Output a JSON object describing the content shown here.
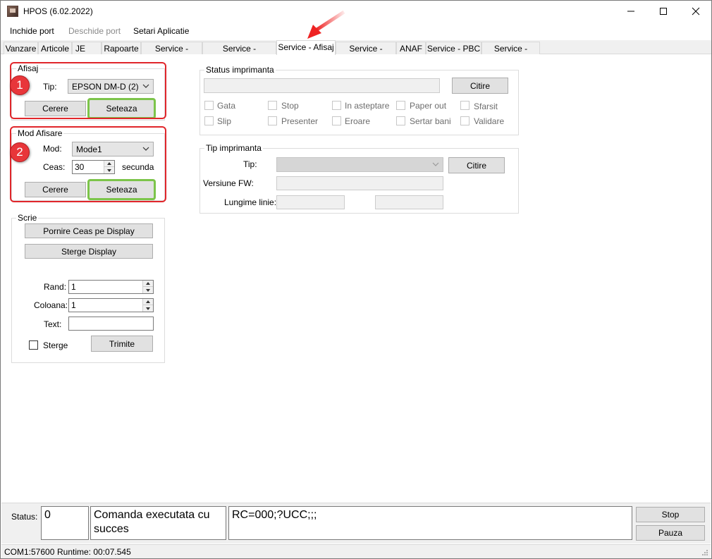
{
  "window": {
    "title": "HPOS (6.02.2022)",
    "controls": {
      "minimize": "—",
      "maximize": "☐",
      "close": "✕"
    }
  },
  "menu": {
    "items": [
      {
        "label": "Inchide port",
        "enabled": true
      },
      {
        "label": "Deschide port",
        "enabled": false
      },
      {
        "label": "Setari Aplicatie",
        "enabled": true
      }
    ]
  },
  "tabs": [
    {
      "label": "Vanzare"
    },
    {
      "label": "Articole"
    },
    {
      "label": "JE"
    },
    {
      "label": "Rapoarte"
    },
    {
      "label": "Service - Fisiere"
    },
    {
      "label": "Service - Fiscalizare"
    },
    {
      "label": "Service - Afisaj",
      "active": true
    },
    {
      "label": "Service - Status"
    },
    {
      "label": "ANAF"
    },
    {
      "label": "Service - PBC"
    },
    {
      "label": "Service - Istoric"
    }
  ],
  "afisaj": {
    "legend": "Afisaj",
    "badge": "1",
    "tip_label": "Tip:",
    "tip_value": "EPSON DM-D (2)",
    "cerere": "Cerere",
    "seteaza": "Seteaza"
  },
  "mod_afisare": {
    "legend": "Mod Afisare",
    "badge": "2",
    "mod_label": "Mod:",
    "mod_value": "Mode1",
    "ceas_label": "Ceas:",
    "ceas_value": "30",
    "unit": "secunda",
    "cerere": "Cerere",
    "seteaza": "Seteaza"
  },
  "scrie": {
    "legend": "Scrie",
    "pornire": "Pornire Ceas pe Display",
    "sterge_display": "Sterge Display",
    "rand_label": "Rand:",
    "rand_value": "1",
    "coloana_label": "Coloana:",
    "coloana_value": "1",
    "text_label": "Text:",
    "text_value": "",
    "sterge_label": "Sterge",
    "trimite": "Trimite"
  },
  "status_imprimanta": {
    "legend": "Status imprimanta",
    "citire": "Citire",
    "checks": [
      "Gata",
      "Stop",
      "In asteptare",
      "Paper out",
      "Sfarsit",
      "Slip",
      "Presenter",
      "Eroare",
      "Sertar bani",
      "Validare"
    ]
  },
  "tip_imprimanta": {
    "legend": "Tip imprimanta",
    "tip_label": "Tip:",
    "citire": "Citire",
    "versiune_label": "Versiune FW:",
    "lungime_label": "Lungime linie:"
  },
  "status": {
    "label": "Status:",
    "code": "0",
    "message": "Comanda executata cu succes",
    "response": "RC=000;?UCC;;;",
    "stop": "Stop",
    "pauza": "Pauza"
  },
  "footer": {
    "port": "COM1:57600",
    "runtime": "Runtime: 00:07.545"
  },
  "colors": {
    "highlight_red": "#e0262b",
    "highlight_green": "#7cc44a"
  }
}
